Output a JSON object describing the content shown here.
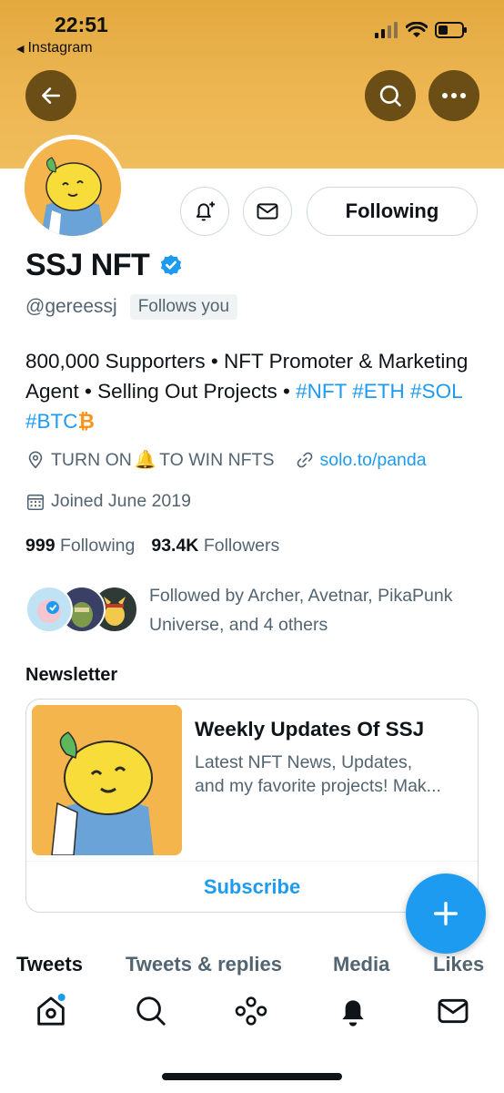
{
  "status_bar": {
    "time": "22:51",
    "back_app": "Instagram"
  },
  "profile": {
    "name": "SSJ NFT",
    "handle": "@gereessj",
    "follows_you": "Follows you",
    "following_button": "Following",
    "bio_parts": {
      "text1": "800,000 Supporters • NFT Promoter & Marketing Agent • Selling Out Projects • ",
      "tag_nft": "#NFT",
      "tag_eth": "#ETH",
      "tag_sol": "#SOL",
      "tag_btc": "#BTC",
      "btc_symbol": "₿"
    },
    "location_before": "TURN ON ",
    "location_emoji": "🔔",
    "location_after": " TO WIN NFTS",
    "website": "solo.to/panda",
    "joined": "Joined June 2019",
    "following_count": "999",
    "following_label": "Following",
    "followers_count": "93.4K",
    "followers_label": "Followers",
    "followed_by": "Followed by Archer, Avetnar, PikaPunk Universe, and 4 others"
  },
  "newsletter": {
    "section_label": "Newsletter",
    "title": "Weekly Updates Of SSJ",
    "desc_line1": "Latest NFT News, Updates,",
    "desc_line2": "and my favorite projects! Mak...",
    "subscribe": "Subscribe"
  },
  "tabs": [
    "Tweets",
    "Tweets & replies",
    "Media",
    "Likes"
  ],
  "colors": {
    "banner": "#edb652",
    "accent": "#1d9bf0",
    "banner_button": "#6b4e16"
  }
}
